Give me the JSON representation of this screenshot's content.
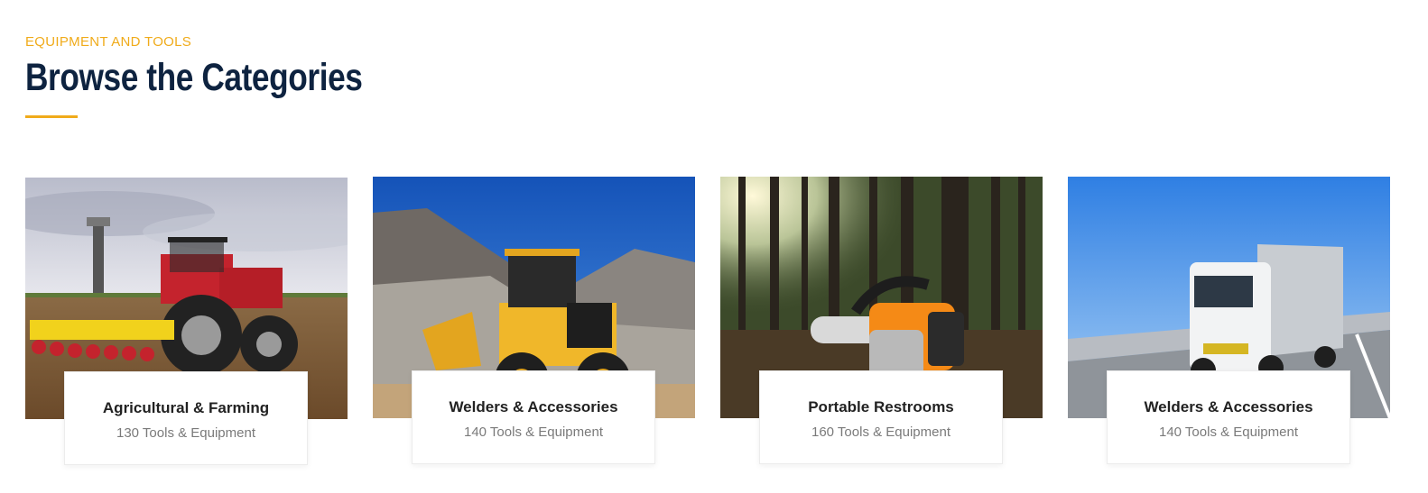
{
  "section": {
    "eyebrow": "EQUIPMENT AND TOOLS",
    "title": "Browse the Categories",
    "accent_color": "#f0ab1a",
    "title_color": "#0e2340"
  },
  "categories": [
    {
      "name": "Agricultural & Farming",
      "count": "130 Tools & Equipment",
      "image": "red tractor with seeder"
    },
    {
      "name": "Welders & Accessories",
      "count": "140 Tools & Equipment",
      "image": "yellow wheel loader in quarry"
    },
    {
      "name": "Portable Restrooms",
      "count": "160 Tools & Equipment",
      "image": "orange chainsaw in forest"
    },
    {
      "name": "Welders & Accessories",
      "count": "140 Tools & Equipment",
      "image": "white truck on highway"
    }
  ]
}
